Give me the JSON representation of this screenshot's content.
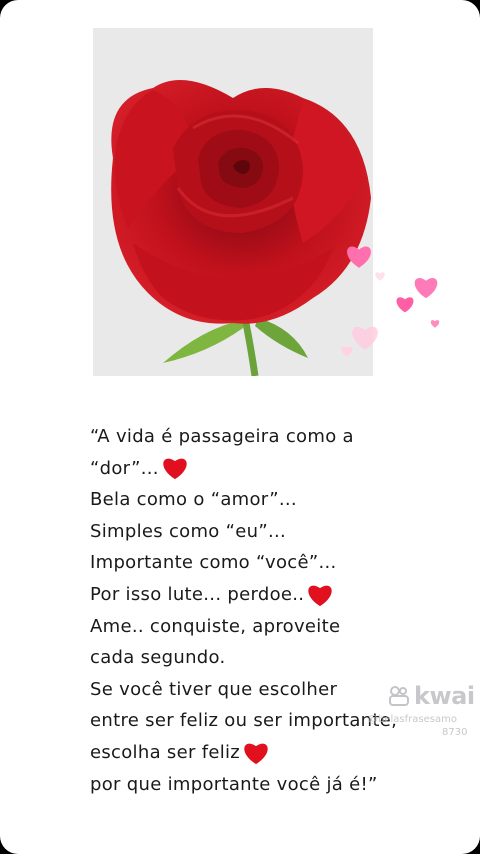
{
  "post": {
    "quote_lines": [
      "“A vida é passageira como a",
      "“dor”...",
      "Bela como o “amor”...",
      "Simples como “eu”...",
      "Importante como “você”...",
      "Por isso lute... perdoe..",
      "Ame.. conquiste, aproveite",
      "cada segundo.",
      "Se você tiver que escolher",
      "entre ser feliz ou ser importante,",
      "escolha ser feliz",
      "por que importante você já é!”"
    ]
  },
  "watermark": {
    "brand": "kwai",
    "handle": "@belasfrasesamo",
    "id": "8730"
  },
  "colors": {
    "rose": "#b3101a",
    "heart": "#e0101e",
    "pink_hearts": "#ff7ab8"
  },
  "icons": [
    "rose-image",
    "heart-emoji",
    "floating-hearts",
    "kwai-logo-icon"
  ]
}
